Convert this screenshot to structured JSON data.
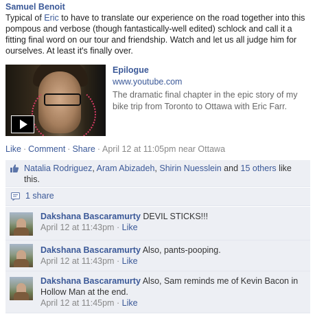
{
  "post": {
    "author": "Samuel Benoit",
    "message_before": "Typical of ",
    "message_link": "Eric",
    "message_after": " to have to translate our experience on the road together into this pompous and verbose (though fantastically-well edited) schlock and call it a fitting final word on our tour and friendship. Watch and let us all judge him for ourselves. At least it's finally over."
  },
  "attachment": {
    "title": "Epilogue",
    "url": "www.youtube.com",
    "description": "The dramatic final chapter in the epic story of my bike trip from Toronto to Ottawa with Eric Farr."
  },
  "actions": {
    "like": "Like",
    "comment": "Comment",
    "share": "Share",
    "separator": "·",
    "timestamp": "April 12 at 11:05pm near Ottawa"
  },
  "likes": {
    "names": [
      "Natalia Rodriguez",
      "Aram Abizadeh",
      "Shirin Nuesslein"
    ],
    "joiner": ", ",
    "and": " and ",
    "others": "15 others",
    "suffix": " like this."
  },
  "shares": {
    "label": "1 share"
  },
  "comments": [
    {
      "author": "Dakshana Bascaramurty",
      "text": " DEVIL STICKS!!!",
      "time": "April 12 at 11:43pm",
      "like": "Like"
    },
    {
      "author": "Dakshana Bascaramurty",
      "text": " Also, pants-pooping.",
      "time": "April 12 at 11:43pm",
      "like": "Like"
    },
    {
      "author": "Dakshana Bascaramurty",
      "text": " Also, Sam reminds me of Kevin Bacon in Hollow Man at the end.",
      "time": "April 12 at 11:45pm",
      "like": "Like"
    }
  ],
  "colors": {
    "link": "#3b5998",
    "panel": "#edeff4",
    "meta": "#888888"
  },
  "icons": {
    "video_play": "play-icon",
    "like": "thumbs-up-icon",
    "share": "share-icon"
  }
}
